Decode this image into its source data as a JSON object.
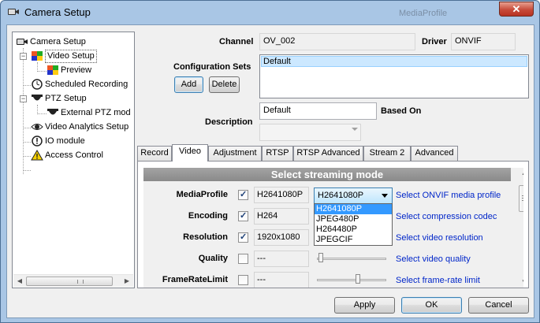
{
  "window": {
    "title": "Camera Setup",
    "ghost_title": "MediaProfile",
    "close_glyph": "✕"
  },
  "tree": {
    "items": [
      {
        "label": "Camera Setup",
        "icon": "camera-icon"
      },
      {
        "label": "Video Setup",
        "icon": "video-grid-icon",
        "selected": true
      },
      {
        "label": "Preview",
        "icon": "preview-grid-icon"
      },
      {
        "label": "Scheduled Recording",
        "icon": "clock-icon"
      },
      {
        "label": "PTZ Setup",
        "icon": "dome-camera-icon"
      },
      {
        "label": "External PTZ mod",
        "icon": "dome-camera-icon"
      },
      {
        "label": "Video Analytics Setup",
        "icon": "eye-icon"
      },
      {
        "label": "IO module",
        "icon": "exclamation-icon"
      },
      {
        "label": "Access Control",
        "icon": "warning-icon"
      }
    ]
  },
  "form": {
    "channel_label": "Channel",
    "channel_value": "OV_002",
    "driver_label": "Driver",
    "driver_value": "ONVIF",
    "config_sets_label": "Configuration Sets",
    "config_sets": [
      "Default"
    ],
    "add_label": "Add",
    "delete_label": "Delete",
    "description_label": "Description",
    "description_value": "Default",
    "based_on_label": "Based On"
  },
  "tabs": [
    "Record",
    "Video",
    "Adjustment",
    "RTSP",
    "RTSP Advanced",
    "Stream 2",
    "Advanced"
  ],
  "active_tab": "Video",
  "streaming": {
    "header": "Select streaming mode",
    "rows": [
      {
        "label": "MediaProfile",
        "checked": true,
        "value": "H2641080P",
        "link": "Select ONVIF media profile"
      },
      {
        "label": "Encoding",
        "checked": true,
        "value": "H264",
        "link": "Select compression codec"
      },
      {
        "label": "Resolution",
        "checked": true,
        "value": "1920x1080",
        "link": "Select video resolution"
      },
      {
        "label": "Quality",
        "checked": false,
        "value": "---",
        "link": "Select video quality",
        "slider": 0.02
      },
      {
        "label": "FrameRateLimit",
        "checked": false,
        "value": "---",
        "link": "Select frame-rate limit",
        "slider": 0.6
      }
    ],
    "combo_value": "H2641080P",
    "dropdown_options": [
      "H2641080P",
      "JPEG480P",
      "H264480P",
      "JPEGCIF"
    ],
    "dropdown_highlighted": "H2641080P"
  },
  "buttons": {
    "apply": "Apply",
    "ok": "OK",
    "cancel": "Cancel"
  },
  "colors": {
    "link": "#0026c9",
    "selection": "#3399ff",
    "titlebar": "#a9c6e5"
  }
}
